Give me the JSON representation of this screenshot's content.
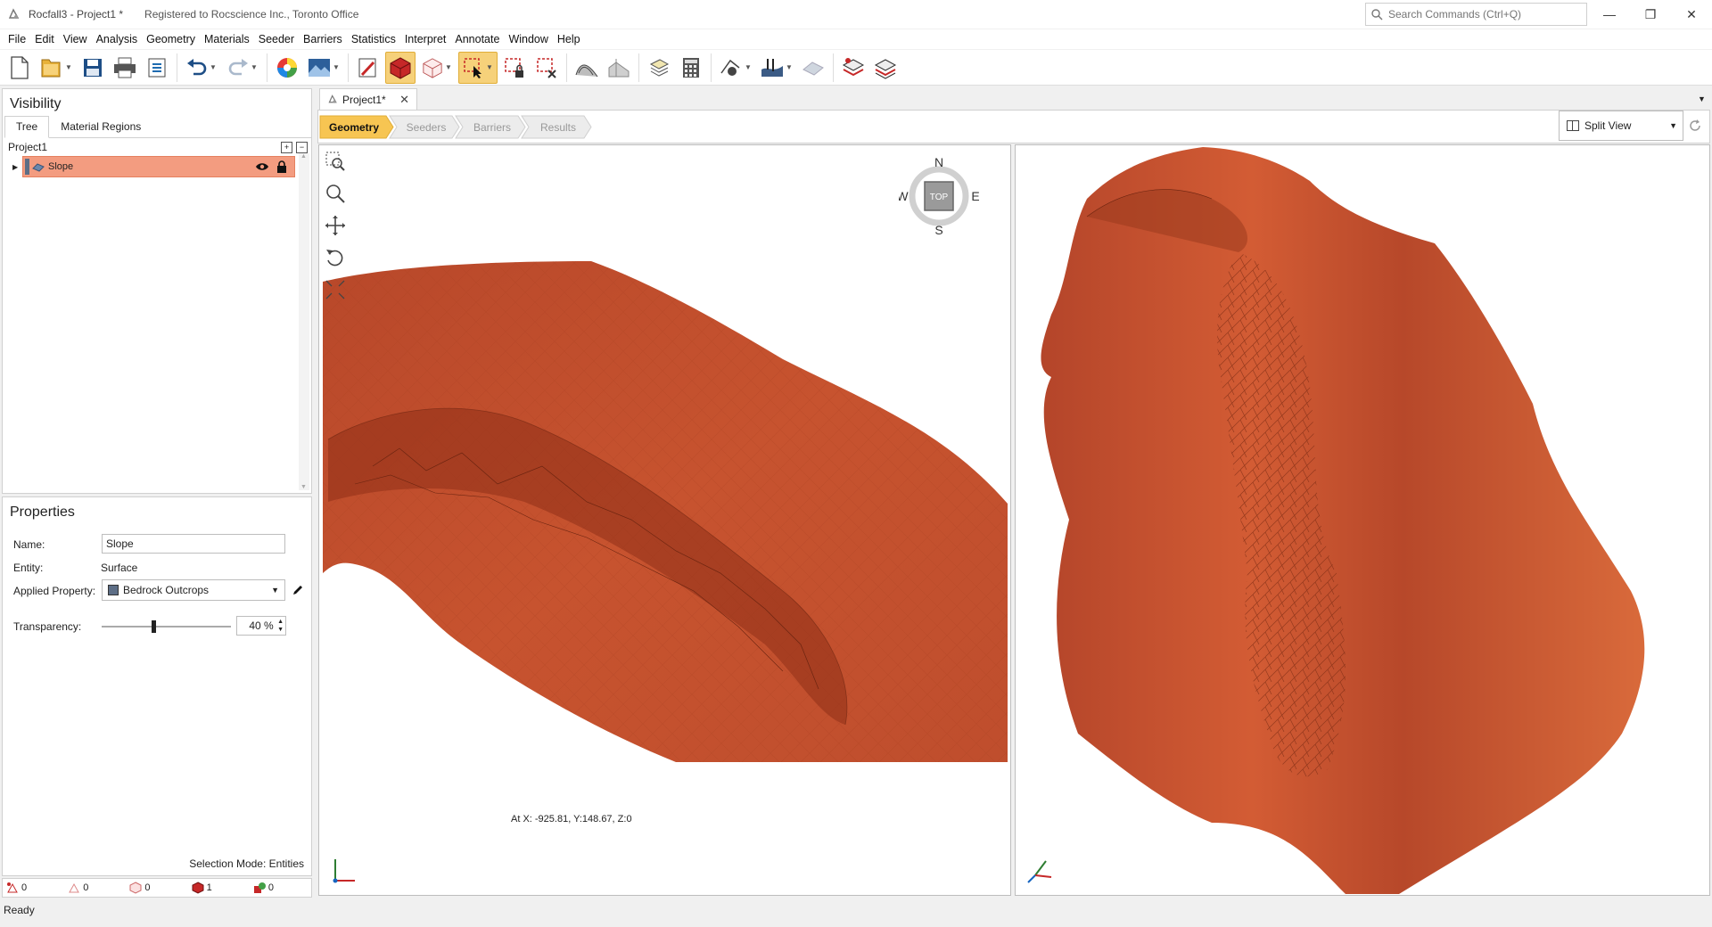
{
  "window": {
    "title": "Rocfall3 - Project1 *",
    "registration": "Registered to Rocscience Inc., Toronto Office",
    "search_placeholder": "Search Commands (Ctrl+Q)"
  },
  "menu": [
    "File",
    "Edit",
    "View",
    "Analysis",
    "Geometry",
    "Materials",
    "Seeder",
    "Barriers",
    "Statistics",
    "Interpret",
    "Annotate",
    "Window",
    "Help"
  ],
  "visibility": {
    "title": "Visibility",
    "tabs": [
      "Tree",
      "Material Regions"
    ],
    "tree_root": "Project1",
    "tree_item": "Slope"
  },
  "properties": {
    "title": "Properties",
    "name_label": "Name:",
    "name_value": "Slope",
    "entity_label": "Entity:",
    "entity_value": "Surface",
    "applied_label": "Applied Property:",
    "applied_value": "Bedrock Outcrops",
    "transparency_label": "Transparency:",
    "transparency_value": "40 %",
    "transparency_fraction": 0.4,
    "selection_mode": "Selection Mode: Entities"
  },
  "counts": [
    "0",
    "0",
    "0",
    "1",
    "0"
  ],
  "document": {
    "tab": "Project1*",
    "workflow": [
      "Geometry",
      "Seeders",
      "Barriers",
      "Results"
    ],
    "view_mode": "Split View"
  },
  "compass": {
    "n": "N",
    "s": "S",
    "e": "E",
    "w": "W",
    "center": "TOP"
  },
  "coord_readout": "At X: -925.81, Y:148.67, Z:0",
  "status": "Ready",
  "colors": {
    "terrain": "#c8502e",
    "terrain_dark": "#8f3017",
    "selection": "#f39c80",
    "workflow_active": "#f7c552"
  }
}
